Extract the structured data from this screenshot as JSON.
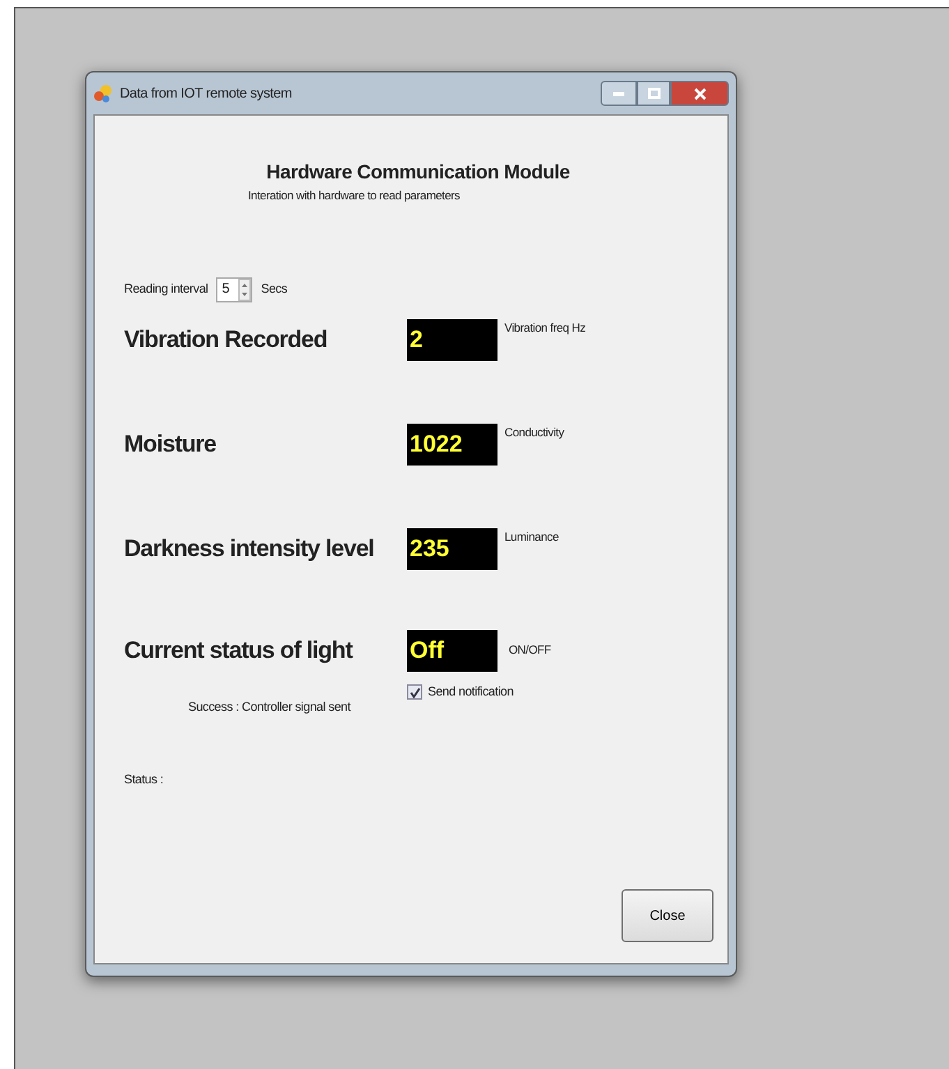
{
  "window": {
    "title": "Data from IOT remote system"
  },
  "heading": "Hardware Communication Module",
  "subheading": "Interation with hardware to read parameters",
  "reading_interval": {
    "label": "Reading interval",
    "value": "5",
    "unit": "Secs"
  },
  "readings": [
    {
      "kind": "measure",
      "label": "Vibration Recorded",
      "value": "2",
      "unit": "Vibration freq Hz"
    },
    {
      "kind": "measure",
      "label": "Moisture",
      "value": "1022",
      "unit": "Conductivity"
    },
    {
      "kind": "measure",
      "label": "Darkness intensity level",
      "value": "235",
      "unit": "Luminance"
    },
    {
      "kind": "state",
      "label": "Current status of light",
      "value": "Off",
      "unit": "ON/OFF"
    }
  ],
  "send_notification": {
    "label": "Send notification",
    "checked": true
  },
  "message": "Success : Controller signal sent",
  "status_label": "Status :",
  "buttons": [
    "Close"
  ]
}
